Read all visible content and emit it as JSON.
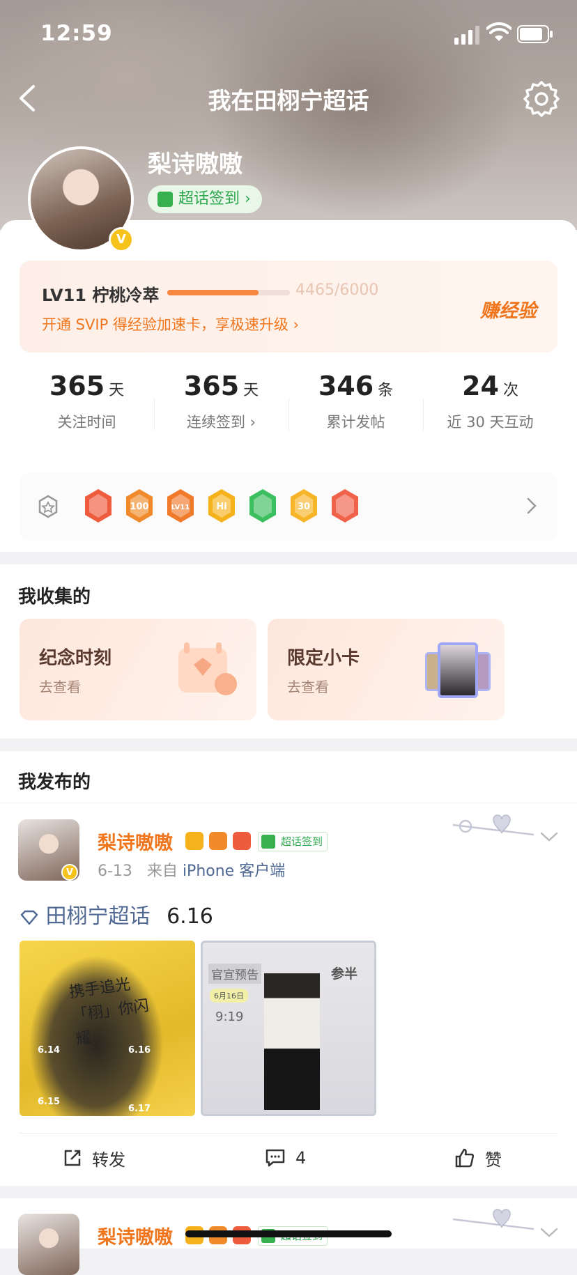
{
  "status": {
    "time": "12:59"
  },
  "nav": {
    "title": "我在田栩宁超话"
  },
  "profile": {
    "name": "梨诗嗷嗷",
    "verify_mark": "V",
    "sign_label": "超话签到 ›"
  },
  "level": {
    "name": "LV11 柠桃冷萃",
    "progress_text": "4465/6000",
    "progress_value": 4465,
    "progress_max": 6000,
    "promo": "开通 SVIP 得经验加速卡，享极速升级 ›",
    "earn_label": "赚经验"
  },
  "stats": [
    {
      "num": "365",
      "unit": "天",
      "label": "关注时间"
    },
    {
      "num": "365",
      "unit": "天",
      "label": "连续签到 ›"
    },
    {
      "num": "346",
      "unit": "条",
      "label": "累计发帖"
    },
    {
      "num": "24",
      "unit": "次",
      "label": "近 30 天互动"
    }
  ],
  "medals": {
    "items": [
      {
        "icon": "rabbit-medal-icon",
        "color": "#ef5b3d",
        "text": ""
      },
      {
        "icon": "100-days-medal-icon",
        "color": "#f08a2a",
        "text": "100"
      },
      {
        "icon": "lv11-medal-icon",
        "color": "#f07a2a",
        "text": "LV11"
      },
      {
        "icon": "hi-medal-icon",
        "color": "#f6b21c",
        "text": "Hi"
      },
      {
        "icon": "hands-medal-icon",
        "color": "#3cbf5e",
        "text": ""
      },
      {
        "icon": "30-days-medal-icon",
        "color": "#f7b62a",
        "text": "30"
      },
      {
        "icon": "rock-hand-medal-icon",
        "color": "#f0624a",
        "text": ""
      }
    ]
  },
  "collection": {
    "title": "我收集的",
    "cards": [
      {
        "title": "纪念时刻",
        "sub": "去查看"
      },
      {
        "title": "限定小卡",
        "sub": "去查看"
      }
    ]
  },
  "posts_section": {
    "title": "我发布的"
  },
  "posts": [
    {
      "author": "梨诗嗷嗷",
      "sign_badge": "超话签到",
      "date": "6-13",
      "from_label": "来自",
      "device": "iPhone 客户端",
      "topic": "田栩宁超话",
      "text": "6.16",
      "image1_caption": "携手追光「栩」你闪耀",
      "image1_dates": [
        "6.14",
        "6.16",
        "6.15",
        "6.17"
      ],
      "image2_tag": "官宣预告",
      "image2_title": "参半",
      "image2_date": "6月16日",
      "image2_time": "9:19",
      "actions": {
        "repost": "转发",
        "comment": "4",
        "like": "赞"
      }
    },
    {
      "author": "梨诗嗷嗷",
      "sign_badge": "超话签到"
    }
  ]
}
